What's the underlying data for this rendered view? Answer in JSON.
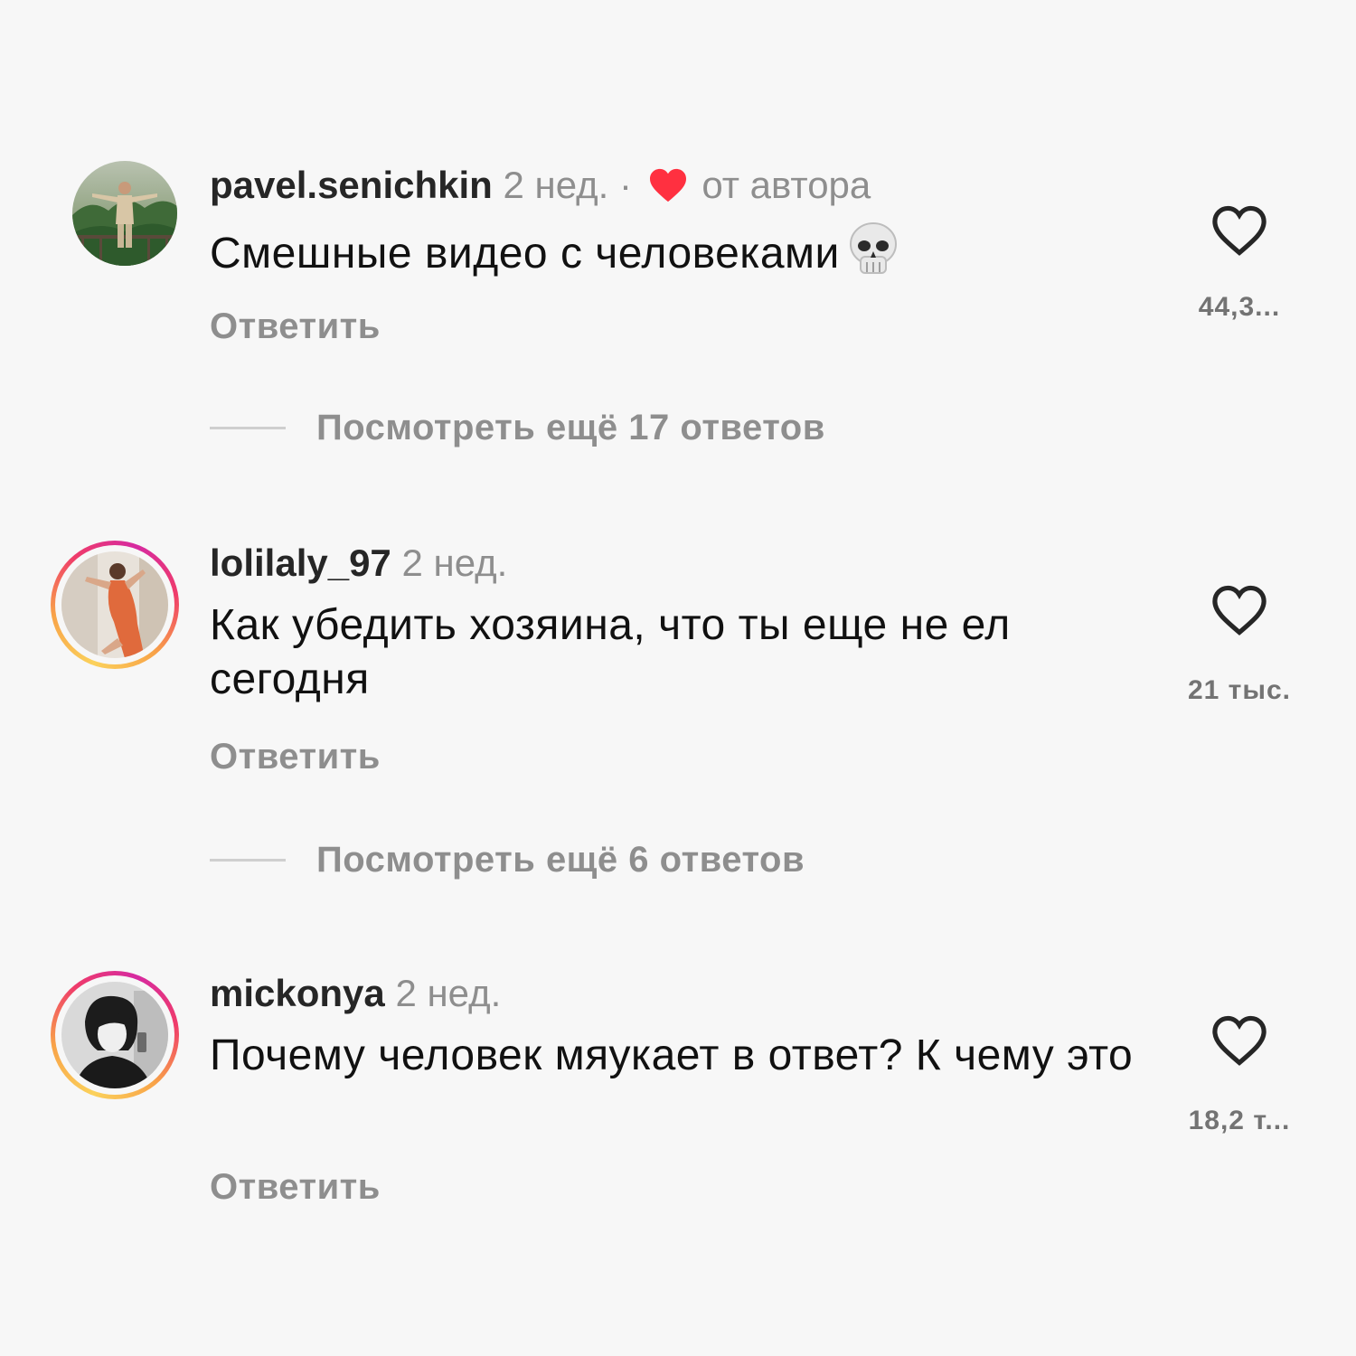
{
  "comments": [
    {
      "username": "pavel.senichkin",
      "time": "2 нед.",
      "separator": "·",
      "author_like_label": "от автора",
      "text": "Смешные видео с человеками",
      "emoji_icon": "skull-icon",
      "reply_label": "Ответить",
      "like_count": "44,3...",
      "more_replies": "Посмотреть ещё 17 ответов",
      "has_story_ring": false
    },
    {
      "username": "lolilaly_97",
      "time": "2 нед.",
      "text": "Как убедить хозяина, что ты еще не ел сегодня",
      "reply_label": "Ответить",
      "like_count": "21 тыс.",
      "more_replies": "Посмотреть ещё 6 ответов",
      "has_story_ring": true
    },
    {
      "username": "mickonya",
      "time": "2 нед.",
      "text": "Почему человек мяукает в ответ? К чему это",
      "reply_label": "Ответить",
      "like_count": "18,2 т...",
      "has_story_ring": true
    }
  ],
  "colors": {
    "background": "#f7f7f7",
    "username": "#262626",
    "meta": "#8e8e8e",
    "author_heart": "#ff3040",
    "like_icon": "#262626"
  }
}
